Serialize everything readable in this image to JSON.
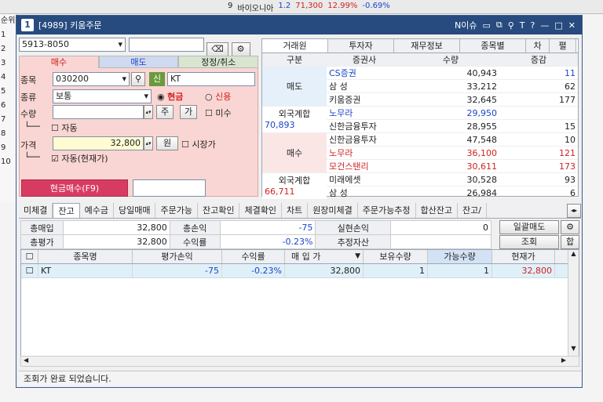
{
  "bg": {
    "row_values": [
      "9",
      "바이오니아",
      "1.2",
      "71,300",
      "12.99%",
      "-0.69%"
    ],
    "side_labels": [
      "순위",
      "1",
      "2",
      "3",
      "4",
      "5",
      "6",
      "7",
      "8",
      "9",
      "10"
    ]
  },
  "window": {
    "badge": "1",
    "title": "[4989] 키움주문",
    "issue_label": "N이슈",
    "help": "?"
  },
  "account": {
    "number": "5913-8050",
    "password": ""
  },
  "order_tabs": [
    "매수",
    "매도",
    "정정/취소"
  ],
  "order": {
    "stock_label": "종목",
    "stock_code": "030200",
    "credit_badge": "신",
    "stock_name": "KT",
    "type_label": "종류",
    "type_value": "보통",
    "cash_label": "현금",
    "credit_label": "신용",
    "qty_label": "수량",
    "qty_value": "",
    "qty_unit": "주",
    "qty_btn": "가",
    "unfilled_label": "미수",
    "auto_label": "자동",
    "price_label": "가격",
    "price_value": "32,800",
    "price_unit": "원",
    "market_label": "시장가",
    "auto_current_label": "자동(현재가)",
    "submit_label": "현금매수(F9)",
    "submit_extra": ""
  },
  "right_tabs": [
    "거래원",
    "투자자",
    "재무정보",
    "종목별",
    "차",
    "펼"
  ],
  "broker_header": [
    "구분",
    "증권사",
    "수량",
    "증감"
  ],
  "sell_label": "매도",
  "buy_label": "매수",
  "foreign_label": "외국계합",
  "sell_foreign_value": "70,893",
  "buy_foreign_value": "66,711",
  "sell_rows": [
    {
      "broker": "CS증권",
      "qty": "40,943",
      "chg": "11"
    },
    {
      "broker": "삼 성",
      "qty": "33,212",
      "chg": "62"
    },
    {
      "broker": "키움증권",
      "qty": "32,645",
      "chg": "177"
    },
    {
      "broker": "노무라",
      "qty": "29,950",
      "chg": ""
    },
    {
      "broker": "신한금융투자",
      "qty": "28,955",
      "chg": "15"
    }
  ],
  "buy_rows": [
    {
      "broker": "신한금융투자",
      "qty": "47,548",
      "chg": "10"
    },
    {
      "broker": "노무라",
      "qty": "36,100",
      "chg": "121"
    },
    {
      "broker": "모건스탠리",
      "qty": "30,611",
      "chg": "173"
    },
    {
      "broker": "미래에셋",
      "qty": "30,528",
      "chg": "93"
    },
    {
      "broker": "삼 성",
      "qty": "26,984",
      "chg": "6"
    }
  ],
  "bottom_tabs": [
    "미체결",
    "잔고",
    "예수금",
    "당일매매",
    "주문가능",
    "잔고확인",
    "체결확인",
    "차트",
    "원장미체결",
    "주문가능추정",
    "합산잔고",
    "잔고/"
  ],
  "summary": {
    "total_buy_label": "총매입",
    "total_buy": "32,800",
    "pnl_label": "총손익",
    "pnl": "-75",
    "realized_label": "실현손익",
    "realized": "0",
    "total_eval_label": "총평가",
    "total_eval": "32,800",
    "return_label": "수익률",
    "return": "-0.23%",
    "est_asset_label": "추정자산",
    "est_asset": "",
    "bulk_sell": "일괄매도",
    "query": "조회",
    "sum_btn": "합"
  },
  "grid_headers": [
    "종목명",
    "평가손익",
    "수익률",
    "매 입 가",
    "보유수량",
    "가능수량",
    "현재가"
  ],
  "grid_rows": [
    {
      "name": "KT",
      "pnl": "-75",
      "ret": "-0.23%",
      "buy": "32,800",
      "hold": "1",
      "avail": "1",
      "cur": "32,800"
    }
  ],
  "status": "조회가 완료 되었습니다.",
  "colors": {
    "title_bar": "#274a7f",
    "buy_panel": "#f9d6d3",
    "submit": "#d83b62"
  }
}
